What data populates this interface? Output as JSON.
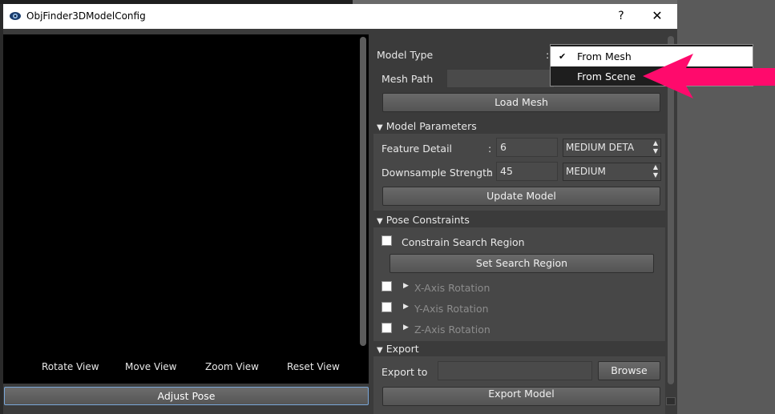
{
  "window": {
    "title": "ObjFinder3DModelConfig",
    "help_label": "?",
    "close_label": "✕"
  },
  "viewport": {
    "buttons": [
      "Rotate View",
      "Move View",
      "Zoom View",
      "Reset View"
    ],
    "adjust_pose_label": "Adjust Pose"
  },
  "model": {
    "type_label": "Model Type",
    "type_colon": ":",
    "mesh_path_label": "Mesh Path",
    "mesh_path_value": "",
    "load_mesh_label": "Load Mesh"
  },
  "dropdown": {
    "options": [
      "From Mesh",
      "From Scene"
    ],
    "checked_option": "From Mesh",
    "highlighted_option": "From Mesh",
    "check_glyph": "✔"
  },
  "model_parameters": {
    "header": "Model Parameters",
    "feature_detail_label": "Feature Detail",
    "feature_detail_colon": ":",
    "feature_detail_value": "6",
    "feature_detail_combo": "MEDIUM DETA",
    "downsample_label": "Downsample Strength",
    "downsample_colon": ":",
    "downsample_value": "45",
    "downsample_combo": "MEDIUM",
    "update_model_label": "Update Model"
  },
  "pose_constraints": {
    "header": "Pose Constraints",
    "constrain_label": "Constrain Search Region",
    "set_region_label": "Set Search Region",
    "rotations": [
      "X-Axis Rotation",
      "Y-Axis Rotation",
      "Z-Axis Rotation"
    ]
  },
  "export": {
    "header": "Export",
    "export_to_label": "Export to",
    "export_to_value": "",
    "browse_label": "Browse",
    "export_model_label": "Export Model"
  },
  "colors": {
    "annotation_arrow": "#ff0a6c",
    "accent_border": "#7aa7d8"
  }
}
